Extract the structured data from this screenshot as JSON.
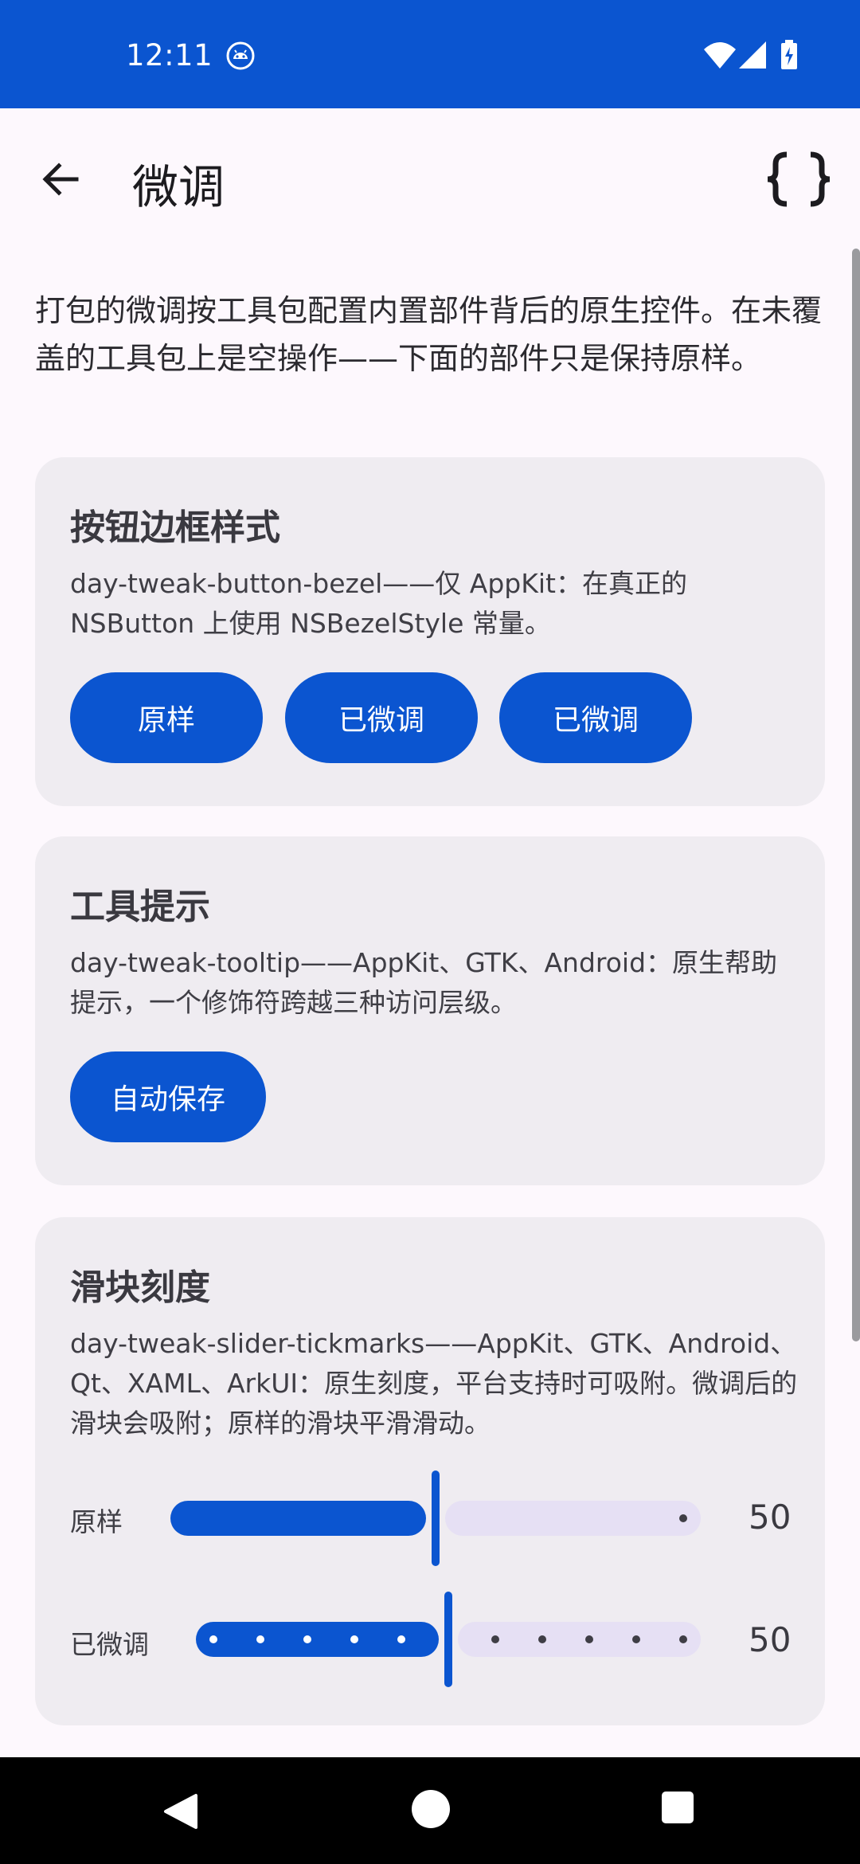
{
  "status_bar": {
    "time": "12:11",
    "icons": [
      "android-debug-icon",
      "wifi-icon",
      "signal-icon",
      "battery-charging-icon"
    ]
  },
  "app_bar": {
    "title": "微调",
    "back_icon": "arrow-back-icon",
    "action_icon": "curly-braces-icon"
  },
  "intro": "打包的微调按工具包配置内置部件背后的原生控件。在未覆盖的工具包上是空操作——下面的部件只是保持原样。",
  "cards": [
    {
      "title": "按钮边框样式",
      "description": "day-tweak-button-bezel——仅 AppKit：在真正的 NSButton 上使用 NSBezelStyle 常量。",
      "buttons": [
        "原样",
        "已微调",
        "已微调"
      ]
    },
    {
      "title": "工具提示",
      "description": "day-tweak-tooltip——AppKit、GTK、Android：原生帮助提示，一个修饰符跨越三种访问层级。",
      "buttons": [
        "自动保存"
      ]
    },
    {
      "title": "滑块刻度",
      "description": "day-tweak-slider-tickmarks——AppKit、GTK、Android、Qt、XAML、ArkUI：原生刻度，平台支持时可吸附。微调后的滑块会吸附；原样的滑块平滑滑动。",
      "sliders": [
        {
          "label": "原样",
          "value": "50",
          "fraction": 0.5,
          "ticks": false
        },
        {
          "label": "已微调",
          "value": "50",
          "fraction": 0.5,
          "ticks": true
        }
      ]
    }
  ],
  "colors": {
    "primary": "#0b55d0",
    "track_inactive": "#e6e0f4",
    "card_bg": "#efecf1",
    "page_bg": "#fdf8fd"
  },
  "nav_bar": {
    "icons": [
      "nav-back-icon",
      "nav-home-icon",
      "nav-recents-icon"
    ]
  }
}
